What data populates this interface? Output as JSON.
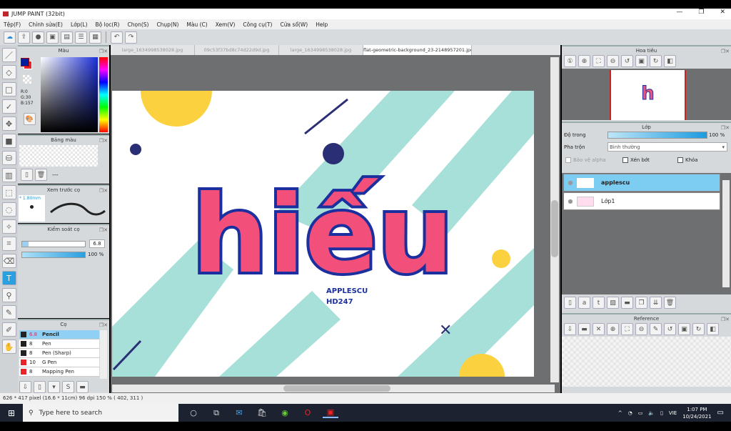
{
  "window": {
    "title": "JUMP PAINT (32bit)",
    "minimize": "—",
    "maximize": "❐",
    "close": "✕"
  },
  "menu": [
    "Tệp(F)",
    "Chỉnh sửa(E)",
    "Lớp(L)",
    "Bộ lọc(R)",
    "Chọn(S)",
    "Chụp(N)",
    "Màu (C)",
    "Xem(V)",
    "Công cụ(T)",
    "Cửa sổ(W)",
    "Help"
  ],
  "tabs": [
    "large_1634998538028.jpg",
    "09c53f37bd8c74d22d9d.jpg",
    "large_1634998538028.jpg",
    "flat-geometric-background_23-2148957201.jpg"
  ],
  "color_panel": {
    "title": "Màu",
    "r": "R:0",
    "g": "G:30",
    "b": "B:157",
    "primary": "#001e9d",
    "secondary": "#e8242b"
  },
  "palette_panel": {
    "title": "Bảng màu",
    "value": "---"
  },
  "brush_preview": {
    "title": "Xem trước cọ",
    "size": "* 1.80mm"
  },
  "brush_control": {
    "title": "Kiểm soát cọ",
    "size": "6.8",
    "opacity": "100 %",
    "opacity_pct": 100
  },
  "brush_panel": {
    "title": "Cọ",
    "items": [
      {
        "size": "6.8",
        "name": "Pencil",
        "color": "#222",
        "selected": true
      },
      {
        "size": "8",
        "name": "Pen",
        "color": "#222"
      },
      {
        "size": "8",
        "name": "Pen (Sharp)",
        "color": "#222"
      },
      {
        "size": "10",
        "name": "G Pen",
        "color": "#e8242b"
      },
      {
        "size": "8",
        "name": "Mapping Pen",
        "color": "#e8242b"
      }
    ]
  },
  "artwork": {
    "word": "hiếu",
    "sub1": "APPLESCU",
    "sub2": "HD247"
  },
  "navigator": {
    "title": "Hoa tiêu"
  },
  "layers": {
    "title": "Lớp",
    "opacity_label": "Độ trong",
    "opacity": "100 %",
    "opacity_pct": 100,
    "blend_label": "Pha trộn",
    "blend": "Bình thường",
    "protect_alpha": "Bảo vệ alpha",
    "clip": "Xén bớt",
    "lock": "Khóa",
    "items": [
      {
        "name": "applescu",
        "selected": true
      },
      {
        "name": "Lớp1"
      }
    ]
  },
  "reference": {
    "title": "Reference"
  },
  "status": "626 * 417 pixel   (16.6 * 11cm)   96 dpi   150 %   ( 402, 311 )",
  "taskbar": {
    "search_placeholder": "Type here to search",
    "lang": "VIE",
    "time": "1:07 PM",
    "date": "10/24/2021"
  }
}
